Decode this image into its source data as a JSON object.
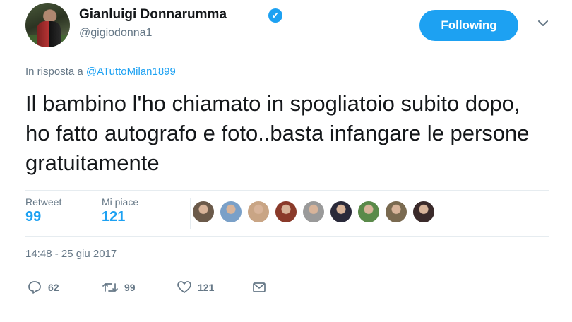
{
  "author": {
    "display_name": "Gianluigi Donnarumma",
    "handle": "@gigiodonna1",
    "verified_glyph": "✔"
  },
  "follow_button": {
    "label": "Following"
  },
  "reply_context": {
    "prefix": "In risposta a",
    "mention": "@ATuttoMilan1899"
  },
  "tweet": {
    "text": "Il bambino l'ho chiamato in spogliatoio subito dopo, ho fatto autografo e foto..basta infangare le persone gratuitamente"
  },
  "stats": {
    "retweets_label": "Retweet",
    "retweets_value": "99",
    "likes_label": "Mi piace",
    "likes_value": "121"
  },
  "likers": [
    {
      "name": "liker-avatar-1",
      "color": "#6b5a4a"
    },
    {
      "name": "liker-avatar-2",
      "color": "#7aa0c8"
    },
    {
      "name": "liker-avatar-3",
      "color": "#c9a585"
    },
    {
      "name": "liker-avatar-4",
      "color": "#8a3a2a"
    },
    {
      "name": "liker-avatar-5",
      "color": "#9a9a9a"
    },
    {
      "name": "liker-avatar-6",
      "color": "#2a2a3a"
    },
    {
      "name": "liker-avatar-7",
      "color": "#5a8a4a"
    },
    {
      "name": "liker-avatar-8",
      "color": "#7a6a50"
    },
    {
      "name": "liker-avatar-9",
      "color": "#3a2a2a"
    }
  ],
  "timestamp": "14:48 - 25 giu 2017",
  "actions": {
    "reply_count": "62",
    "retweet_count": "99",
    "like_count": "121"
  },
  "colors": {
    "accent": "#1da1f2",
    "muted": "#657786",
    "text": "#14171a",
    "border": "#e6ecf0"
  },
  "icons": [
    "verified-icon",
    "chevron-down-icon",
    "reply-icon",
    "retweet-icon",
    "like-icon",
    "direct-message-icon"
  ]
}
